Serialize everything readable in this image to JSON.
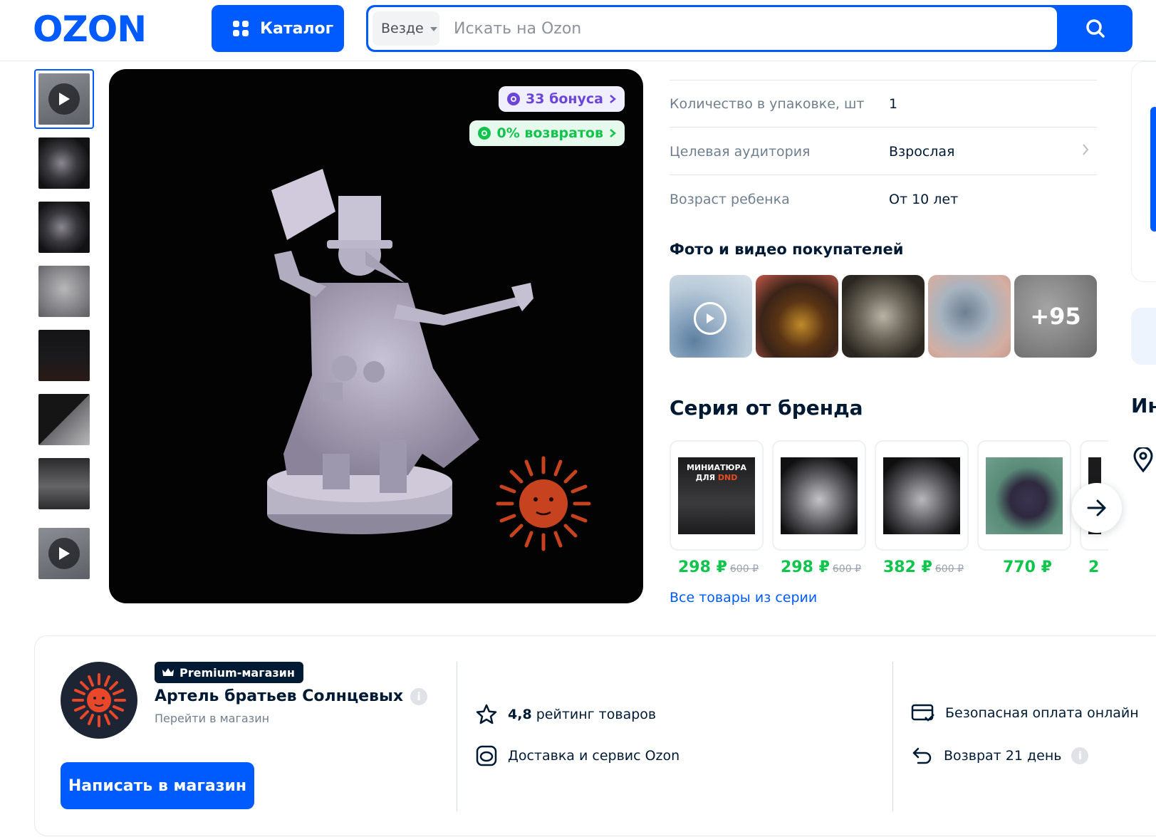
{
  "header": {
    "logo_text": "OZON",
    "catalog_label": "Каталог",
    "search_scope": "Везде",
    "search_placeholder": "Искать на Ozon"
  },
  "badges": {
    "bonus": "33 бонуса",
    "returns": "0% возвратов"
  },
  "characteristics": [
    {
      "key": "Количество в упаковке, шт",
      "value": "1"
    },
    {
      "key": "Целевая аудитория",
      "value": "Взрослая"
    },
    {
      "key": "Возраст ребенка",
      "value": "От 10 лет"
    }
  ],
  "customer_media": {
    "title": "Фото и видео покупателей",
    "more_count": "+95"
  },
  "brand_series": {
    "title": "Серия от бренда",
    "items": [
      {
        "title_line1": "МИНИАТЮРА",
        "title_line2": "ДЛЯ",
        "title_accent": "DND",
        "price": "298 ₽",
        "old_price": "600 ₽"
      },
      {
        "price": "298 ₽",
        "old_price": "600 ₽"
      },
      {
        "price": "382 ₽",
        "old_price": "600 ₽"
      },
      {
        "price": "770 ₽",
        "old_price": ""
      },
      {
        "price": "2",
        "old_price": ""
      }
    ],
    "all_link": "Все товары из серии"
  },
  "side": {
    "title": "Ин"
  },
  "seller": {
    "premium_label": "Premium-магазин",
    "name": "Артель братьев Солнцевых",
    "go_to_store": "Перейти в магазин",
    "write_button": "Написать в магазин",
    "rating_value": "4,8",
    "rating_text": "рейтинг товаров",
    "delivery": "Доставка и сервис Ozon",
    "payment": "Безопасная оплата онлайн",
    "return": "Возврат 21 день"
  },
  "colors": {
    "brand_blue": "#005bff",
    "price_green": "#10c44c",
    "bonus_purple": "#6c44d8",
    "text_dark": "#001a34",
    "text_muted": "#707f8d"
  }
}
